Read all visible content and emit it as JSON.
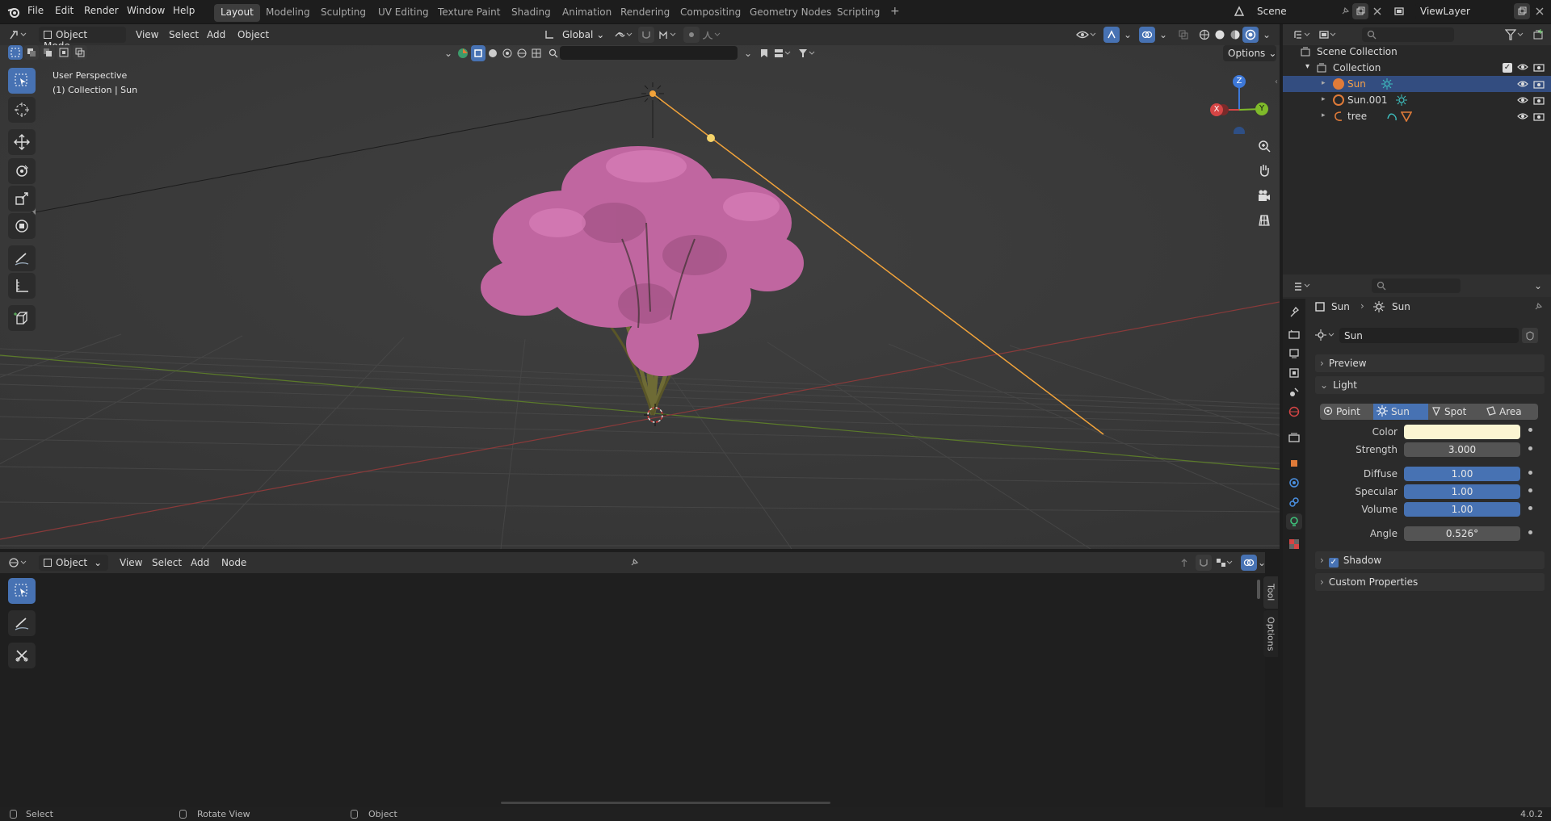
{
  "topbar": {
    "menus": [
      "File",
      "Edit",
      "Render",
      "Window",
      "Help"
    ],
    "workspaces": [
      "Layout",
      "Modeling",
      "Sculpting",
      "UV Editing",
      "Texture Paint",
      "Shading",
      "Animation",
      "Rendering",
      "Compositing",
      "Geometry Nodes",
      "Scripting"
    ],
    "active_workspace": "Layout",
    "add_tab": "+",
    "scene": "Scene",
    "view_layer": "ViewLayer"
  },
  "viewport_header": {
    "mode": "Object Mode",
    "menus": [
      "View",
      "Select",
      "Add",
      "Object"
    ],
    "transform_orientation": "Global",
    "options": "Options"
  },
  "viewport": {
    "perspective": "User Perspective",
    "collection_info": "(1) Collection | Sun",
    "gizmo": {
      "z": "Z",
      "x": "X",
      "y": "Y"
    },
    "colors": {
      "sun_line": "#f2a33a",
      "foliage": "#c066a0",
      "grid_x": "#8a3a3a",
      "grid_y": "#5b7a2a"
    }
  },
  "node_editor_header": {
    "type": "Object",
    "menus": [
      "View",
      "Select",
      "Add",
      "Node"
    ]
  },
  "node_editor": {
    "side_tabs": [
      "Tool",
      "Options"
    ]
  },
  "outliner": {
    "root": "Scene Collection",
    "collection": "Collection",
    "items": [
      "Sun",
      "Sun.001",
      "tree"
    ]
  },
  "properties": {
    "breadcrumb": [
      "Sun",
      "Sun"
    ],
    "datablock_name": "Sun",
    "panels": {
      "preview": "Preview",
      "light": "Light",
      "shadow": "Shadow",
      "custom": "Custom Properties"
    },
    "light_types": [
      "Point",
      "Sun",
      "Spot",
      "Area"
    ],
    "active_light_type": "Sun",
    "color_label": "Color",
    "color_value": "#fbf5d2",
    "fields": [
      {
        "label": "Strength",
        "value": "3.000"
      },
      {
        "label": "Diffuse",
        "value": "1.00"
      },
      {
        "label": "Specular",
        "value": "1.00"
      },
      {
        "label": "Volume",
        "value": "1.00"
      },
      {
        "label": "Angle",
        "value": "0.526°"
      }
    ]
  },
  "statusbar": {
    "items": [
      "Select",
      "Rotate View",
      "Object"
    ],
    "version": "4.0.2"
  }
}
